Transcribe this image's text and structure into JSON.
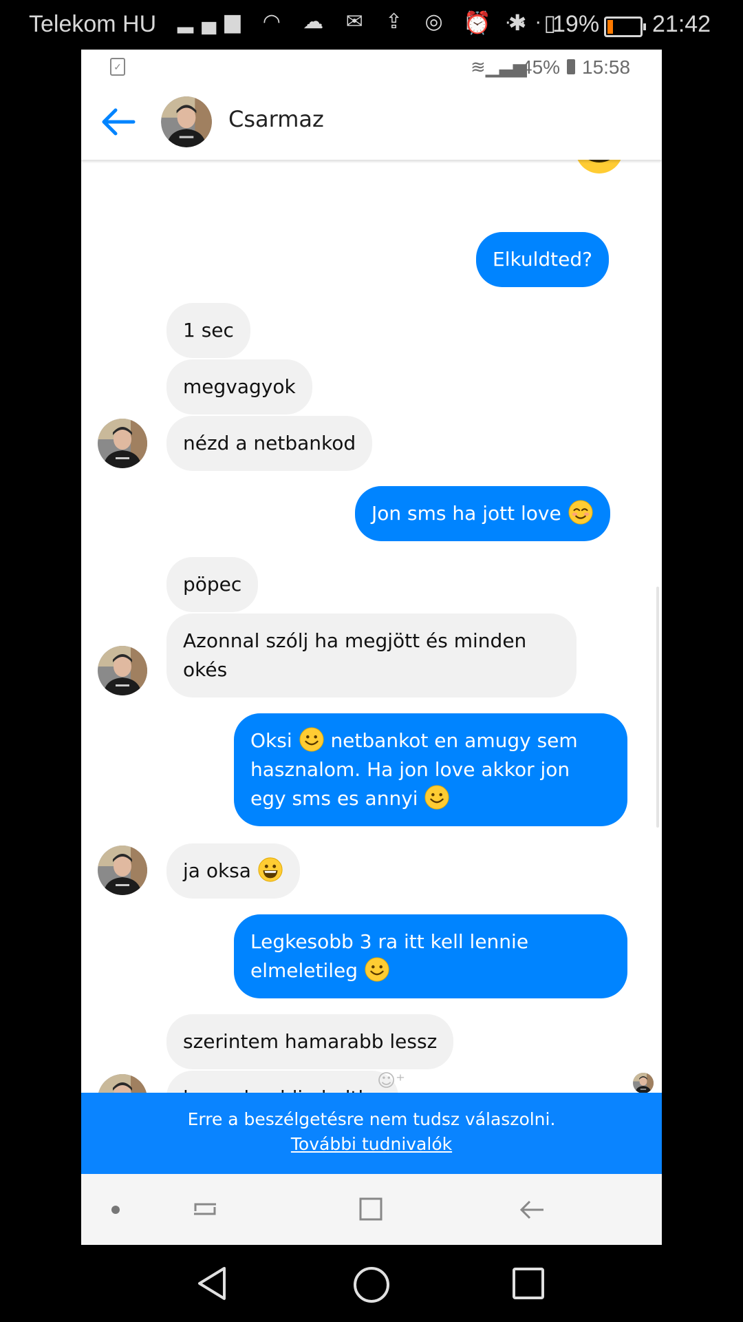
{
  "outer_status": {
    "carrier": "Telekom HU",
    "battery": "19%",
    "time": "21:42",
    "left_icons": "▂▄▆ ◠ ☁ ✉ ⇪ ◎ ◻ ···",
    "right_icons": "⏰ ✱ ▯"
  },
  "inner_status": {
    "battery": "45%",
    "time": "15:58"
  },
  "header": {
    "contact_name": "Csarmaz"
  },
  "messages": [
    {
      "side": "out",
      "text": "Elkuldted?"
    },
    {
      "side": "in",
      "text": "1 sec"
    },
    {
      "side": "in",
      "text": "megvagyok"
    },
    {
      "side": "in",
      "text": "nézd a netbankod"
    },
    {
      "side": "out",
      "text": "Jon sms ha jott love",
      "emoji_after": "blush"
    },
    {
      "side": "in",
      "text": "pöpec"
    },
    {
      "side": "in",
      "line1": "Azonnal szólj ha megjött és minden",
      "line2": "okés"
    },
    {
      "side": "out",
      "line1a": "Oksi",
      "line1b": "netbankot en amugy sem",
      "line2": "hasznalom. Ha jon love akkor jon",
      "line3": "egy sms es annyi"
    },
    {
      "side": "in",
      "text": "ja oksa",
      "emoji_after": "grin"
    },
    {
      "side": "out",
      "line1": "Legkesobb 3 ra itt kell lennie",
      "line2": "elmeletileg"
    },
    {
      "side": "in",
      "text": "szerintem hamarabb lessz"
    },
    {
      "side": "in",
      "text": "leugrok addig boltba"
    }
  ],
  "banner": {
    "text": "Erre a beszélgetésre nem tudsz válaszolni.",
    "link": "További tudnivalók"
  },
  "colors": {
    "accent": "#0084ff",
    "incoming_bubble": "#f1f1f1",
    "banner": "#0a84ff"
  },
  "icons": {
    "back": "back-arrow-icon",
    "react": "add-reaction-icon"
  }
}
